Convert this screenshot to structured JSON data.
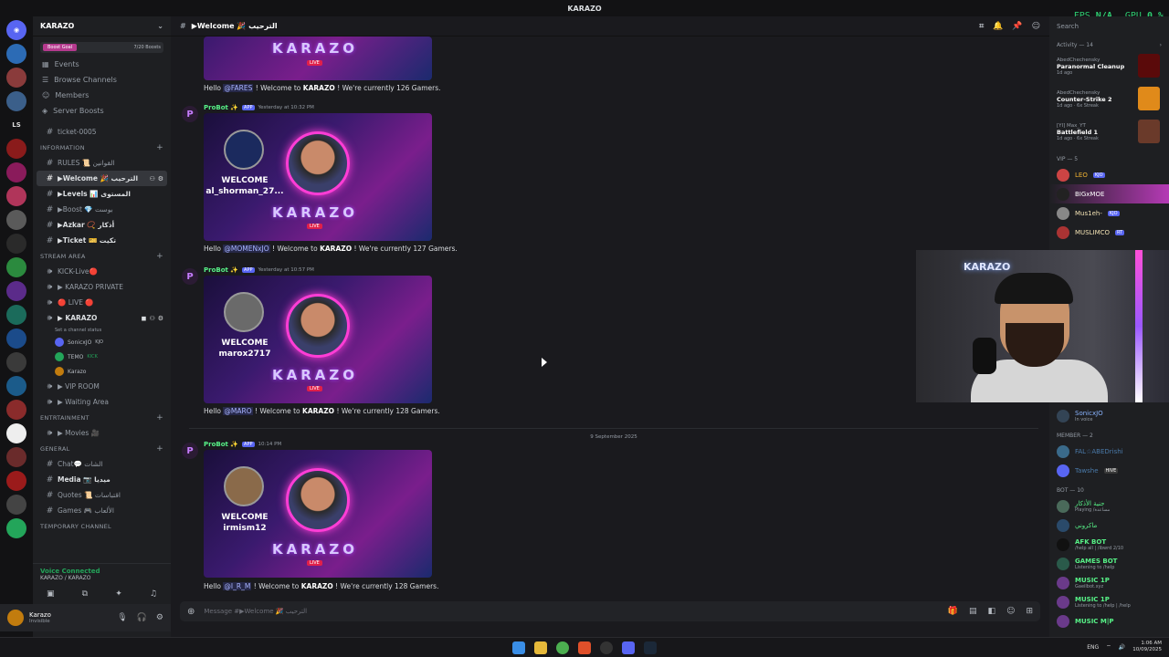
{
  "window": {
    "title": "KARAZO",
    "fps_label": "FPS",
    "fps_value": "N/A",
    "gpu_label": "GPU",
    "gpu_value": "0 %"
  },
  "server": {
    "name": "KARAZO",
    "boost_goal": "Boost Goal",
    "boost_count": "7/20 Boosts"
  },
  "nav": [
    "Events",
    "Browse Channels",
    "Members",
    "Server Boosts"
  ],
  "channels": {
    "ticket": "ticket-0005",
    "cat_information": "INFORMATION",
    "rules": "RULES 📜 القوانين",
    "welcome": "▶Welcome 🎉 الترحيب",
    "levels": "▶Levels 📊 المستوى",
    "boost": "▶Boost 💎 بوست",
    "azkar": "▶Azkar 📿 أذكار",
    "ticket_ch": "▶Ticket 🎫 تكيت",
    "cat_stream": "STREAM AREA",
    "kick_live": "KICK-Live🔴",
    "karazo_private": "▶ KARAZO PRIVATE",
    "live": "🔴 LIVE 🔴",
    "karazo_voice": "▶ KARAZO",
    "channel_status": "Set a channel status",
    "voice_users": [
      "SonicxJO",
      "TEMO",
      "Karazo"
    ],
    "voice_tags": [
      "KJO",
      "KICK",
      ""
    ],
    "vip_room": "▶ VIP ROOM",
    "waiting_area": "▶ Waiting Area",
    "cat_entertainment": "ENTRTAINMENT",
    "movies": "▶ Movies 🎥",
    "cat_general": "GENERAL",
    "chat": "Chat💬 الشات",
    "media": "Media 📷 ميديا",
    "quotes": "Quotes 📜 اقتباسات",
    "games": "Games 🎮 الألعاب",
    "cat_temp": "TEMPORARY CHANNEL"
  },
  "voice": {
    "status": "Voice Connected",
    "location": "KARAZO / KARAZO"
  },
  "user": {
    "name": "Karazo",
    "status": "Invisible"
  },
  "chat_header": {
    "title": "▶Welcome 🎉 الترحيب"
  },
  "messages": [
    {
      "hello": "Hello",
      "mention": "@FARES",
      "rest": "! Welcome to",
      "server": "KARAZO",
      "count_text": "! We're currently 126 Gamers."
    },
    {
      "author": "ProBot ✨",
      "tag": "APP",
      "time": "Yesterday at 10:32 PM",
      "welcome": "WELCOME",
      "wname": "al_shorman_27...",
      "hello": "Hello",
      "mention": "@MOMENxJO",
      "rest": "! Welcome to",
      "server": "KARAZO",
      "count_text": "! We're currently 127 Gamers."
    },
    {
      "author": "ProBot ✨",
      "tag": "APP",
      "time": "Yesterday at 10:57 PM",
      "welcome": "WELCOME",
      "wname": "marox2717",
      "hello": "Hello",
      "mention": "@MARO",
      "rest": "! Welcome to",
      "server": "KARAZO",
      "count_text": "! We're currently 128 Gamers."
    },
    {
      "author": "ProBot ✨",
      "tag": "APP",
      "time": "10:14 PM",
      "welcome": "WELCOME",
      "wname": "irmism12",
      "hello": "Hello",
      "mention": "@I_R_M",
      "rest": "! Welcome to",
      "server": "KARAZO",
      "count_text": "! We're currently 128 Gamers."
    }
  ],
  "banner": {
    "logo": "KARAZO",
    "live": "LIVE"
  },
  "date_separator": "9 September 2025",
  "input": {
    "placeholder": "Message #▶Welcome 🎉 الترحيب"
  },
  "members": {
    "search": "Search",
    "activity_label": "Activity — 14",
    "activity": [
      {
        "user": "AbedChechensky",
        "game": "Paranormal Cleanup",
        "sub": "1d ago"
      },
      {
        "user": "AbedChechensky",
        "game": "Counter-Strike 2",
        "sub": "1d ago · 6x Streak"
      },
      {
        "user": "[YI] Max_YT",
        "game": "Battlefield 1",
        "sub": "1d ago · 6x Streak"
      }
    ],
    "vip_cat": "VIP — 5",
    "vip": [
      "LEO",
      "BIGxMOE",
      "Mus1eh-",
      "MUSLIMCO"
    ],
    "vip_tags": [
      "KJO",
      "",
      "KJO",
      "RT"
    ],
    "voice_user": "SonicxJO",
    "voice_user_sub": "In voice",
    "member_cat": "MEMBER — 2",
    "member_list": [
      "FAL☆ABEDrishi",
      "Tawshe"
    ],
    "member_tags": [
      "",
      "HIVE"
    ],
    "bot_cat": "BOT — 10",
    "bots": [
      "جنية الأذكار",
      "ماكروني",
      "AFK BOT",
      "GAMES BOT",
      "MUSIC 1P",
      "MUSIC 1P",
      "MUSIC M|P"
    ],
    "bot_subs": [
      "Playing /مساعدة",
      "ماكروني",
      "/help all | /ibwrd 2/10",
      "Listening to /help",
      "Gaeilbot.xyz",
      "Listening to /help | /help",
      ""
    ]
  },
  "taskbar": {
    "lang": "ENG",
    "time": "1:06 AM",
    "date": "10/09/2025"
  }
}
